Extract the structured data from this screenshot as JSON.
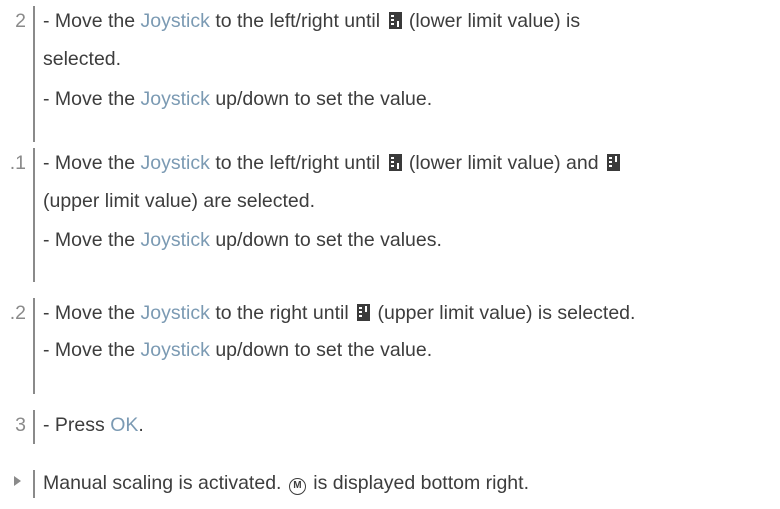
{
  "steps": [
    {
      "number": "2",
      "lines": [
        {
          "prefix": "- Move the ",
          "highlight": "Joystick",
          "text_a": " to the left/right until ",
          "icon1": "lower-limit-icon",
          "text_b": " (lower limit value) is"
        },
        {
          "text": "selected."
        },
        {
          "prefix": "- Move the ",
          "highlight": "Joystick",
          "text_a": " up/down to set the value."
        }
      ]
    },
    {
      "number": ".1",
      "lines": [
        {
          "prefix": "- Move the ",
          "highlight": "Joystick",
          "text_a": " to the left/right until ",
          "icon1": "lower-limit-icon",
          "text_b": " (lower limit value) and ",
          "icon2": "upper-limit-icon"
        },
        {
          "text": "(upper limit value) are selected."
        },
        {
          "prefix": "- Move the ",
          "highlight": "Joystick",
          "text_a": " up/down to set the values."
        }
      ]
    },
    {
      "number": ".2",
      "lines": [
        {
          "prefix": "- Move the ",
          "highlight": "Joystick",
          "text_a": " to the right until ",
          "icon1": "upper-limit-icon",
          "text_b": " (upper limit value) is selected."
        },
        {
          "prefix": "- Move the ",
          "highlight": "Joystick",
          "text_a": " up/down to set the value."
        }
      ]
    },
    {
      "number": "3",
      "lines": [
        {
          "prefix": "- Press ",
          "highlight": "OK",
          "text_a": "."
        }
      ]
    }
  ],
  "result": {
    "icon": "result-triangle-icon",
    "text_a": "Manual scaling is activated. ",
    "symbol": "M",
    "symbol_icon": "manual-scaling-icon",
    "text_b": " is displayed bottom right."
  },
  "colors": {
    "highlight": "#7b9ab3",
    "number": "#8a8a8a",
    "text": "#3d3d3d"
  }
}
